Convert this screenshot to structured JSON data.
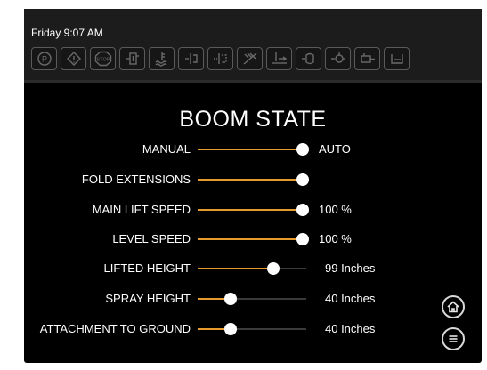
{
  "status": {
    "datetime": "Friday 9:07 AM"
  },
  "indicator_icons": [
    {
      "name": "parking-brake-icon"
    },
    {
      "name": "warning-icon"
    },
    {
      "name": "stop-icon",
      "text": "STOP"
    },
    {
      "name": "fuel-filter-icon"
    },
    {
      "name": "coolant-temp-icon"
    },
    {
      "name": "boom-fold-icon"
    },
    {
      "name": "boom-extension-icon"
    },
    {
      "name": "spray-off-icon"
    },
    {
      "name": "level-icon"
    },
    {
      "name": "tank-flow-icon"
    },
    {
      "name": "engine-oil-icon"
    },
    {
      "name": "hydraulic-icon"
    },
    {
      "name": "def-tank-icon"
    }
  ],
  "page": {
    "title": "BOOM STATE"
  },
  "rows": [
    {
      "label": "MANUAL",
      "value": "AUTO",
      "level": 0.97
    },
    {
      "label": "FOLD EXTENSIONS",
      "value": "",
      "level": 0.97
    },
    {
      "label": "MAIN LIFT SPEED",
      "value": "100 %",
      "level": 0.97
    },
    {
      "label": "LEVEL SPEED",
      "value": "100 %",
      "level": 0.97
    },
    {
      "label": "LIFTED HEIGHT",
      "value": "99 Inches",
      "level": 0.7
    },
    {
      "label": "SPRAY HEIGHT",
      "value": "40 Inches",
      "level": 0.3
    },
    {
      "label": "ATTACHMENT TO GROUND",
      "value": "40 Inches",
      "level": 0.3
    }
  ],
  "colors": {
    "accent": "#e69a2c",
    "background": "#000000",
    "topbar": "#1c1c1c"
  }
}
